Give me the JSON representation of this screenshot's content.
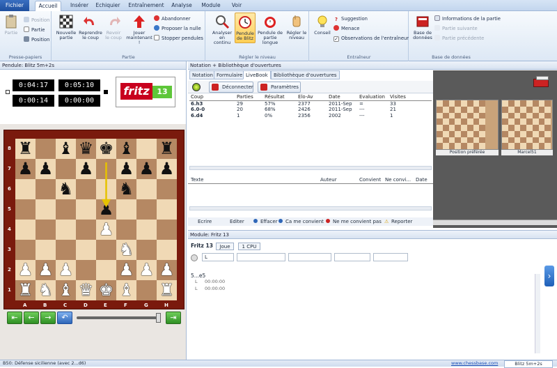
{
  "menubar": {
    "file_tab": "Fichier",
    "tabs": [
      "Accueil",
      "Insérer",
      "Echiquier",
      "Entraînement",
      "Analyse",
      "Module",
      "Voir"
    ]
  },
  "ribbon": {
    "clipboard": {
      "label": "Presse-papiers",
      "partie": "Partie",
      "position1": "Position",
      "partie2": "Partie",
      "position2": "Position"
    },
    "game": {
      "label": "Partie",
      "new_game": "Nouvelle partie",
      "take_back": "Reprendre le coup",
      "see_move": "Revoir le coup",
      "play_now": "Jouer maintenant !",
      "abandon": "Abandonner",
      "propose_draw": "Proposer la nulle",
      "stop_clocks": "Stopper pendules"
    },
    "level": {
      "label": "Régler le niveau",
      "analyze": "Analyser en continu",
      "blitz_clock": "Pendule de Blitz",
      "long_clock": "Pendule de partie longue",
      "set_level": "Régler le niveau"
    },
    "trainer": {
      "label": "Entraîneur",
      "advice": "Conseil",
      "suggestion": "Suggestion",
      "threat": "Menace",
      "observations": "Observations de l'entraîneur"
    },
    "database": {
      "label": "Base de données",
      "database_btn": "Base de données",
      "game_info": "Informations de la partie",
      "next_game": "Partie suivante",
      "prev_game": "Partie précédente"
    }
  },
  "clock_panel": {
    "title": "Pendule: Blitz 5m+2s",
    "white_time": "0:04:17",
    "black_time": "0:05:10",
    "white_move": "0:00:14",
    "black_move": "0:00:00",
    "logo_text": "fritz",
    "logo_num": "13"
  },
  "board": {
    "files": [
      "A",
      "B",
      "C",
      "D",
      "E",
      "F",
      "G",
      "H"
    ],
    "ranks": [
      "8",
      "7",
      "6",
      "5",
      "4",
      "3",
      "2",
      "1"
    ],
    "pieces": [
      [
        "r",
        "",
        "b",
        "q",
        "k",
        "b",
        "",
        "r"
      ],
      [
        "p",
        "p",
        "",
        "p",
        "",
        "p",
        "p",
        "p"
      ],
      [
        "",
        "",
        "n",
        "",
        "",
        "n",
        "",
        ""
      ],
      [
        "",
        "",
        "",
        "",
        "p",
        "",
        "",
        ""
      ],
      [
        "",
        "",
        "",
        "",
        "P",
        "",
        "",
        ""
      ],
      [
        "",
        "",
        "",
        "",
        "",
        "N",
        "",
        ""
      ],
      [
        "P",
        "P",
        "P",
        "",
        "",
        "P",
        "P",
        "P"
      ],
      [
        "R",
        "N",
        "B",
        "Q",
        "K",
        "B",
        "",
        "R"
      ]
    ]
  },
  "notation_panel": {
    "title": "Notation + Bibliothèque d'ouvertures",
    "tabs": [
      "Notation",
      "Formulaire",
      "LiveBook",
      "Bibliothèque d'ouvertures"
    ],
    "disconnect": "Déconnecter",
    "params": "Paramètres",
    "columns": [
      "Coup",
      "Parties",
      "Résultat",
      "Elo-Av",
      "Date",
      "Evaluation",
      "Visites"
    ],
    "rows": [
      [
        "6.h3",
        "29",
        "57%",
        "2377",
        "2011-Sep",
        "=",
        "33"
      ],
      [
        "6.0-0",
        "20",
        "68%",
        "2426",
        "2011-Sep",
        "---",
        "21"
      ],
      [
        "6.d4",
        "1",
        "0%",
        "2356",
        "2002",
        "---",
        "1"
      ]
    ],
    "comment_columns": [
      "Texte",
      "Auteur",
      "Convient",
      "Ne convi...",
      "Date"
    ],
    "actions": [
      "Ecrire",
      "Editer",
      "Effacer",
      "Ca me convient",
      "Ne me convient pas",
      "Reporter"
    ]
  },
  "thumbs": {
    "left_label": "Position préférée",
    "right_label": "Marcel51"
  },
  "engine_panel": {
    "title": "Module: Fritz 13",
    "engine_name": "Fritz 13",
    "play_btn": "Joue",
    "cpu_btn": "1 CPU",
    "field1": "L",
    "line_move": "5...e5",
    "sub1_label": "L",
    "sub1_time": "00:00:00",
    "sub2_label": "L",
    "sub2_time": "00:00:00"
  },
  "statusbar": {
    "opening": "B50: Défense sicilienne (avec 2...d6)",
    "link": "www.chessbase.com",
    "mode": "Blitz 5m+2s"
  }
}
